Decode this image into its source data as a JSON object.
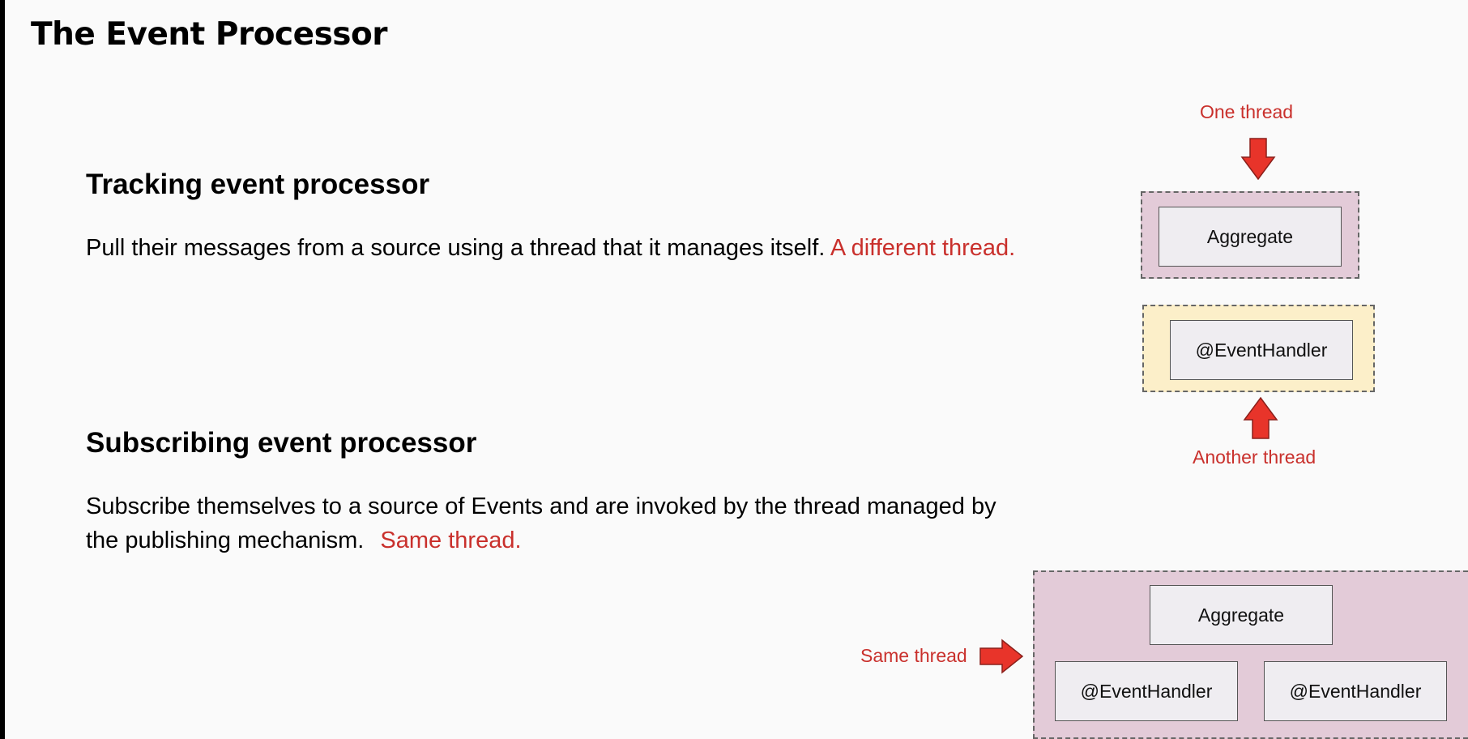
{
  "title": "The Event Processor",
  "tracking": {
    "heading": "Tracking event processor",
    "text": "Pull their messages from a source using a thread that it manages itself.",
    "highlight": "A different thread."
  },
  "subscribing": {
    "heading": "Subscribing event processor",
    "text_line1": "Subscribe themselves to a source of Events and are invoked by the thread managed by",
    "text_line2": "the publishing mechanism.",
    "highlight": "Same thread."
  },
  "diagram_tracking": {
    "top_label": "One thread",
    "aggregate_label": "Aggregate",
    "handler_label": "@EventHandler",
    "bottom_label": "Another thread"
  },
  "diagram_subscribing": {
    "side_label": "Same thread",
    "aggregate_label": "Aggregate",
    "handler_labels": [
      "@EventHandler",
      "@EventHandler"
    ]
  },
  "colors": {
    "accent_red": "#c9302c",
    "arrow_red": "#e8342a",
    "container_pink": "#e3cbd8",
    "container_yellow": "#fcefc9",
    "box_fill": "#efedf1"
  }
}
